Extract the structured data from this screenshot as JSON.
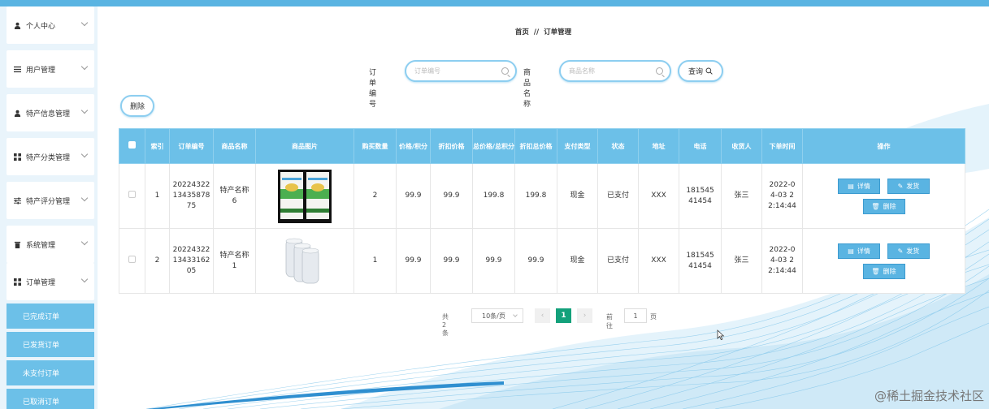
{
  "sidebar": {
    "items": [
      {
        "label": "个人中心",
        "icon": "user-icon"
      },
      {
        "label": "用户管理",
        "icon": "list-icon"
      },
      {
        "label": "特产信息管理",
        "icon": "user-icon"
      },
      {
        "label": "特产分类管理",
        "icon": "grid-icon"
      },
      {
        "label": "特产评分管理",
        "icon": "sliders-icon"
      },
      {
        "label": "系统管理",
        "icon": "trash-icon"
      },
      {
        "label": "订单管理",
        "icon": "grid-icon"
      }
    ],
    "sub_items": [
      "已完成订单",
      "已发货订单",
      "未支付订单",
      "已取消订单"
    ]
  },
  "breadcrumb": {
    "home": "首页",
    "sep": "//",
    "current": "订单管理"
  },
  "search": {
    "order_no_label": "订单编号",
    "order_no_placeholder": "订单编号",
    "product_name_label": "商品名称",
    "product_name_placeholder": "商品名称",
    "query_button": "查询"
  },
  "toolbar": {
    "delete_label": "删除"
  },
  "table": {
    "headers": [
      "索引",
      "订单编号",
      "商品名称",
      "商品图片",
      "购买数量",
      "价格/积分",
      "折扣价格",
      "总价格/总积分",
      "折扣总价格",
      "支付类型",
      "状态",
      "地址",
      "电话",
      "收货人",
      "下单时间",
      "操作"
    ],
    "rows": [
      {
        "index": "1",
        "order_no": "2022432213435878 75",
        "product_name": "特产名称6",
        "quantity": "2",
        "price": "99.9",
        "discount_price": "99.9",
        "total_price": "199.8",
        "discount_total": "199.8",
        "pay_type": "现金",
        "status": "已支付",
        "address": "XXX",
        "phone": "18154541454",
        "receiver": "张三",
        "order_time": "2022-04-03 22:14:44"
      },
      {
        "index": "2",
        "order_no": "2022432213433162 05",
        "product_name": "特产名称1",
        "quantity": "1",
        "price": "99.9",
        "discount_price": "99.9",
        "total_price": "99.9",
        "discount_total": "99.9",
        "pay_type": "现金",
        "status": "已支付",
        "address": "XXX",
        "phone": "18154541454",
        "receiver": "张三",
        "order_time": "2022-04-03 22:14:44"
      }
    ],
    "actions": {
      "detail": "详情",
      "ship": "发货",
      "delete": "删除"
    }
  },
  "pagination": {
    "total": "共 2 条",
    "page_size": "10条/页",
    "current_page": "1",
    "goto_label": "前往",
    "goto_value": "1",
    "unit": "页"
  },
  "watermark": "@稀土掘金技术社区",
  "colors": {
    "accent": "#5ab4e2",
    "header_bg": "#6cc0e8",
    "active_page": "#13a17b",
    "sidebar_bg": "#e9f4fb"
  }
}
